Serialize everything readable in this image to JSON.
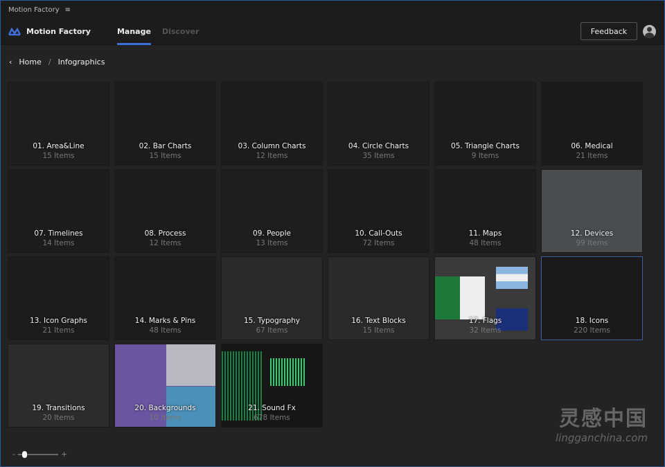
{
  "titlebar": {
    "title": "Motion Factory",
    "menu_icon": "hamburger-icon"
  },
  "nav": {
    "app_name": "Motion Factory",
    "tabs": [
      {
        "label": "Manage",
        "active": true
      },
      {
        "label": "Discover",
        "active": false
      }
    ],
    "feedback_label": "Feedback"
  },
  "breadcrumb": {
    "home": "Home",
    "separator": "/",
    "current": "Infographics"
  },
  "tiles": [
    {
      "title": "01. Area&Line",
      "count": "15 Items",
      "bg": "#1e1e1e"
    },
    {
      "title": "02. Bar Charts",
      "count": "15 Items",
      "bg": "#1c1c1c"
    },
    {
      "title": "03. Column Charts",
      "count": "12 Items",
      "bg": "#1c1c1c"
    },
    {
      "title": "04. Circle Charts",
      "count": "35 Items",
      "bg": "#1e1e1e"
    },
    {
      "title": "05. Triangle Charts",
      "count": "9 Items",
      "bg": "#1c1c1c"
    },
    {
      "title": "06. Medical",
      "count": "21 Items",
      "bg": "#1a1a1a"
    },
    {
      "title": "07. Timelines",
      "count": "14 Items",
      "bg": "#1c1c1c"
    },
    {
      "title": "08. Process",
      "count": "12 Items",
      "bg": "#1c1c1c"
    },
    {
      "title": "09. People",
      "count": "13 Items",
      "bg": "#1e1e1e"
    },
    {
      "title": "10. Call-Outs",
      "count": "72 Items",
      "bg": "#1c1c1c"
    },
    {
      "title": "11. Maps",
      "count": "48 Items",
      "bg": "#1c1c1c"
    },
    {
      "title": "12. Devices",
      "count": "99 Items",
      "bg": "#4a4d50"
    },
    {
      "title": "13. Icon Graphs",
      "count": "21 Items",
      "bg": "#1c1c1c"
    },
    {
      "title": "14. Marks & Pins",
      "count": "48 Items",
      "bg": "#1c1c1c"
    },
    {
      "title": "15. Typography",
      "count": "67 Items",
      "bg": "#2a2a2a"
    },
    {
      "title": "16. Text Blocks",
      "count": "15 Items",
      "bg": "#2a2a2a"
    },
    {
      "title": "17. Flags",
      "count": "32 Items",
      "bg": "#3a3a3a"
    },
    {
      "title": "18. Icons",
      "count": "220 Items",
      "bg": "#1a1a1a",
      "selected": true
    },
    {
      "title": "19. Transitions",
      "count": "20 Items",
      "bg": "#2c2c2c"
    },
    {
      "title": "20. Backgrounds",
      "count": "10 Items",
      "bg": "#6a55a0"
    },
    {
      "title": "21. Sound Fx",
      "count": "678 Items",
      "bg": "#161616"
    }
  ],
  "zoom_slider": {
    "minus": "-",
    "plus": "+",
    "value": 0.1
  },
  "watermark": {
    "cn": "灵感中国",
    "en": "lingganchina.com"
  },
  "colors": {
    "accent": "#3d6fd6",
    "background": "#232323"
  }
}
